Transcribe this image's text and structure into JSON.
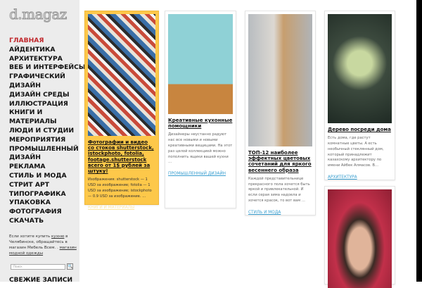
{
  "logo": "d.magaz",
  "nav": [
    {
      "label": "ГЛАВНАЯ",
      "active": true
    },
    {
      "label": "АЙДЕНТИКА"
    },
    {
      "label": "АРХИТЕКТУРА"
    },
    {
      "label": "ВЕБ И ИНТЕРФЕЙСЫ"
    },
    {
      "label": "ГРАФИЧЕСКИЙ"
    },
    {
      "label": "ДИЗАЙН"
    },
    {
      "label": "ДИЗАЙН СРЕДЫ"
    },
    {
      "label": "ИЛЛЮСТРАЦИЯ"
    },
    {
      "label": "КНИГИ И"
    },
    {
      "label": "МАТЕРИАЛЫ"
    },
    {
      "label": "ЛЮДИ И СТУДИИ"
    },
    {
      "label": "МЕРОПРИЯТИЯ"
    },
    {
      "label": "ПРОМЫШЛЕННЫЙ"
    },
    {
      "label": "ДИЗАЙН"
    },
    {
      "label": "РЕКЛАМА"
    },
    {
      "label": "СТИЛЬ И МОДА"
    },
    {
      "label": "СТРИТ АРТ"
    },
    {
      "label": "ТИПОГРАФИКА"
    },
    {
      "label": "УПАКОВКА"
    },
    {
      "label": "ФОТОГРАФИЯ"
    },
    {
      "label": "СКАЧАТЬ"
    }
  ],
  "note": {
    "pre": "Если хотите купить ",
    "link1": "кухню",
    "mid": " в Челябинске, обращайтесь в магазин Мебель Всем. . ",
    "link2": "магазин модной одежды"
  },
  "search": {
    "placeholder": "Поиск",
    "button": "🔍"
  },
  "recent_title": "СВЕЖИЕ ЗАПИСИ",
  "posts": [
    {
      "title": "Фотографии и видео со стоков shutterstock, istockphoto, fotolia, footage.shutterstock всего от 1$ рублей за штуку!",
      "text": "Изображения: shutterstock — 1 USD за изображение; fotolia — 1 USD за изображение; istockphoto — 0.9 USD за изображение. …",
      "category": "КНИГИ И МАТЕРИАЛЫ"
    },
    {
      "title": "Креативные кухонные помощники",
      "text": "Дизайнеры неустанно радуют нас все новыми и новыми креативными вещицами. На этот раз целой коллекцией можно пополнить ящики вашей кухни …",
      "category": "ПРОМЫШЛЕННЫЙ ДИЗАЙН"
    },
    {
      "title": "ТОП-12 наиболее эффектных цветовых сочетаний для яркого весеннего образа",
      "text": "Каждой представительнице прекрасного пола хочется быть яркой и привлекательной. И если серая зима надоела и хочется красок, то вот вам …",
      "category": "СТИЛЬ И МОДА"
    },
    {
      "title": "Дерево посреди дома",
      "text": "Есть дома, где растут комнатные цветы. А есть необычный стеклянный дом, который принадлежит казахскому архитектору по имени Айбек Алмасов. В…",
      "category": "АРХИТЕКТУРА"
    }
  ]
}
